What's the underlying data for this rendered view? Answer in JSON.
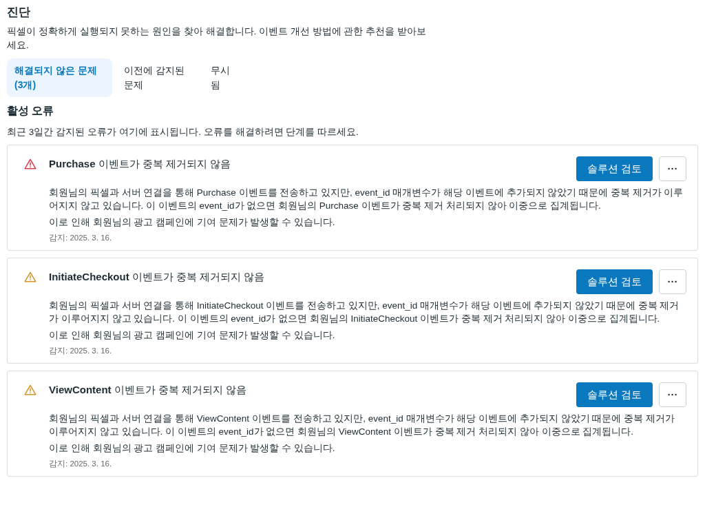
{
  "title": "진단",
  "description": "픽셀이 정확하게 실행되지 못하는 원인을 찾아 해결합니다. 이벤트 개선 방법에 관한 추천을 받아보세요.",
  "tabs": [
    {
      "label": "해결되지 않은 문제(3개)",
      "selected": true
    },
    {
      "label": "이전에 감지된 문제",
      "selected": false
    },
    {
      "label": "무시됨",
      "selected": false
    }
  ],
  "section": {
    "title": "활성 오류",
    "subtitle": "최근 3일간 감지된 오류가 여기에 표시됩니다. 오류를 해결하려면 단계를 따르세요."
  },
  "issues": [
    {
      "color": "#d93f4c",
      "title": "**Purchase** 이벤트가 중복 제거되지 않음",
      "body": "회원님의 픽셀과 서버 연결을 통해 Purchase 이벤트를 전송하고 있지만, event_id 매개변수가 해당 이벤트에 추가되지 않았기 때문에 중복 제거가 이루어지지 않고 있습니다. 이 이벤트의 event_id가 없으면 회원님의 Purchase 이벤트가 중복 제거 처리되지 않아 이중으로 집계됩니다.",
      "impact": "이로 인해 회원님의 광고 캠페인에 기여 문제가 발생할 수 있습니다.",
      "detected": "감지: 2025. 3. 16.",
      "action": "솔루션 검토",
      "more": "···"
    },
    {
      "color": "#d4942a",
      "title": "**InitiateCheckout** 이벤트가 중복 제거되지 않음",
      "body": "회원님의 픽셀과 서버 연결을 통해 InitiateCheckout 이벤트를 전송하고 있지만, event_id 매개변수가 해당 이벤트에 추가되지 않았기 때문에 중복 제거가 이루어지지 않고 있습니다. 이 이벤트의 event_id가 없으면 회원님의 InitiateCheckout 이벤트가 중복 제거 처리되지 않아 이중으로 집계됩니다.",
      "impact": "이로 인해 회원님의 광고 캠페인에 기여 문제가 발생할 수 있습니다.",
      "detected": "감지: 2025. 3. 16.",
      "action": "솔루션 검토",
      "more": "···"
    },
    {
      "color": "#d4942a",
      "title": "**ViewContent** 이벤트가 중복 제거되지 않음",
      "body": "회원님의 픽셀과 서버 연결을 통해 ViewContent 이벤트를 전송하고 있지만, event_id 매개변수가 해당 이벤트에 추가되지 않았기 때문에 중복 제거가 이루어지지 않고 있습니다. 이 이벤트의 event_id가 없으면 회원님의 ViewContent 이벤트가 중복 제거 처리되지 않아 이중으로 집계됩니다.",
      "impact": "이로 인해 회원님의 광고 캠페인에 기여 문제가 발생할 수 있습니다.",
      "detected": "감지: 2025. 3. 16.",
      "action": "솔루션 검토",
      "more": "···"
    }
  ]
}
